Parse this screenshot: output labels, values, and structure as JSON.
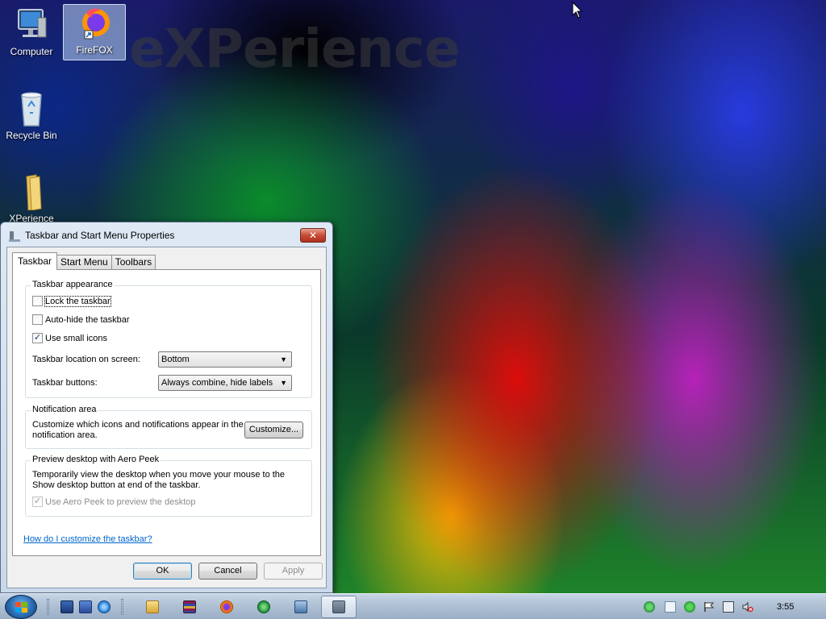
{
  "desktop": {
    "watermark": "eXPerience",
    "icons": [
      {
        "label": "Computer",
        "icon": "computer-icon"
      },
      {
        "label": "FireFOX",
        "icon": "firefox-icon"
      },
      {
        "label": "Recycle Bin",
        "icon": "recycle-bin-icon"
      },
      {
        "label": "XPerience",
        "icon": "folder-icon"
      }
    ]
  },
  "dialog": {
    "title": "Taskbar and Start Menu Properties",
    "close_label": "✕",
    "tabs": [
      {
        "label": "Taskbar"
      },
      {
        "label": "Start Menu"
      },
      {
        "label": "Toolbars"
      }
    ],
    "appearance": {
      "group_label": "Taskbar appearance",
      "lock_label": "Lock the taskbar",
      "lock_checked": false,
      "autohide_label": "Auto-hide the taskbar",
      "autohide_checked": false,
      "small_icons_label": "Use small icons",
      "small_icons_checked": true,
      "location_label": "Taskbar location on screen:",
      "location_value": "Bottom",
      "buttons_label": "Taskbar buttons:",
      "buttons_value": "Always combine, hide labels"
    },
    "notification": {
      "group_label": "Notification area",
      "description_line1": "Customize which icons and notifications appear in the",
      "description_line2": "notification area.",
      "customize_label": "Customize..."
    },
    "aero_peek": {
      "group_label": "Preview desktop with Aero Peek",
      "description_line1": "Temporarily view the desktop when you move your mouse to the",
      "description_line2": "Show desktop button at end of the taskbar.",
      "checkbox_label": "Use Aero Peek to preview the desktop",
      "checked": true,
      "enabled": false
    },
    "help_link": "How do I customize the taskbar?",
    "buttons": {
      "ok": "OK",
      "cancel": "Cancel",
      "apply": "Apply"
    }
  },
  "taskbar": {
    "quick_launch": [
      "show-desktop-icon",
      "switch-windows-icon",
      "internet-explorer-icon"
    ],
    "pinned": [
      "explorer-folder-icon",
      "winrar-icon",
      "firefox-icon",
      "network-globe-icon",
      "network-tool-icon",
      "taskbar-properties-icon"
    ],
    "tray_icons": [
      "network-icon",
      "notepad-icon",
      "security-icon",
      "action-center-flag-icon",
      "network-connection-icon",
      "volume-muted-icon"
    ],
    "clock": "3:55"
  },
  "colors": {
    "link": "#0066cc",
    "close_button": "#c74b34",
    "taskbar": "#aebfd3"
  }
}
